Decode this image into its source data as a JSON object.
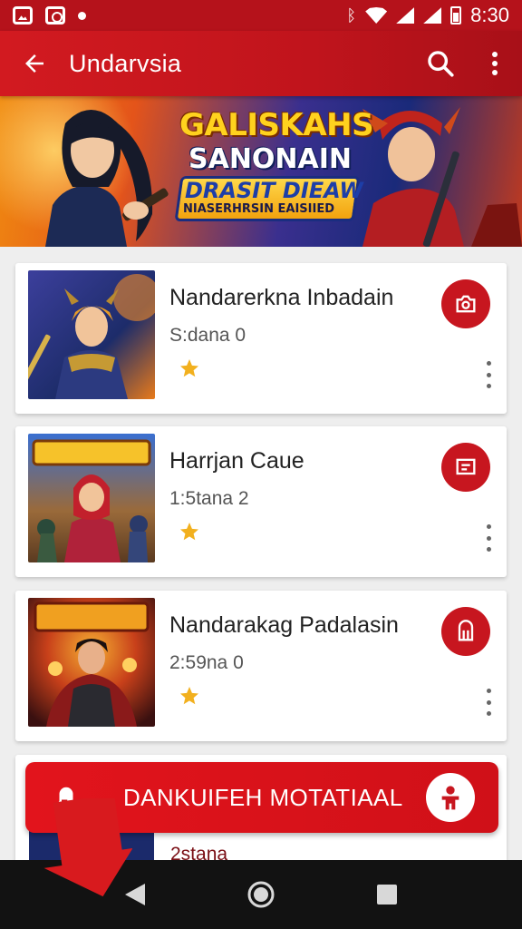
{
  "status_bar": {
    "time": "8:30",
    "icons": [
      "photo-icon",
      "instagram-icon",
      "dot-icon",
      "bluetooth-icon",
      "wifi-icon",
      "signal-icon",
      "signal-icon",
      "battery-icon"
    ]
  },
  "app_bar": {
    "title": "Undarvsia",
    "back_icon": "arrow-left-icon",
    "search_icon": "search-icon",
    "more_icon": "more-vertical-icon"
  },
  "banner": {
    "line1": "GALISKAHS",
    "line2": "SANONAIN",
    "line3": "DRASIT DIEAW",
    "line4": "NIASERHRSIN EAISIIED"
  },
  "games": [
    {
      "name": "Nandarerkna Inbadain",
      "meta": "S:dana 0",
      "rating_icon": "star-icon",
      "action_icon": "camera-icon"
    },
    {
      "name": "Harrjan Caue",
      "meta": "1:5tana 2",
      "rating_icon": "star-icon",
      "action_icon": "screen-icon"
    },
    {
      "name": "Nandarakag Padalasin",
      "meta": "2:59na 0",
      "rating_icon": "star-icon",
      "action_icon": "door-icon"
    }
  ],
  "partial_item": {
    "meta": "2stana"
  },
  "cta": {
    "label": "DANKUIFEH MOTATIAAL",
    "left_icon": "bell-icon",
    "right_icon": "person-icon"
  },
  "colors": {
    "primary": "#c7161f",
    "status_bar": "#b5121b",
    "nav_bar": "#121212",
    "star": "#f2b01e"
  },
  "nav": {
    "back_icon": "nav-back-icon",
    "home_icon": "nav-home-icon",
    "recents_icon": "nav-recents-icon"
  }
}
